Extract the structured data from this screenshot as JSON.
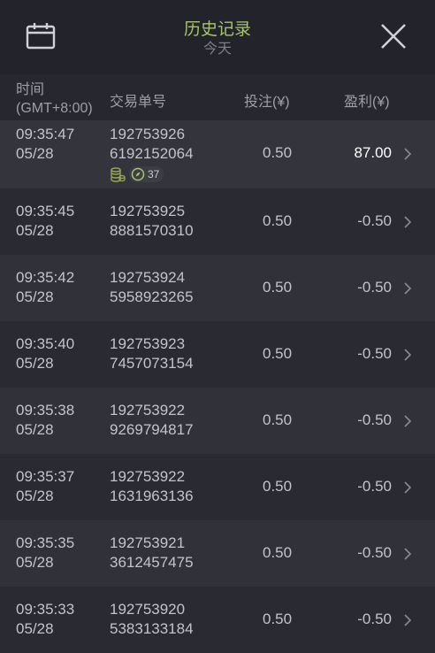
{
  "header": {
    "title": "历史记录",
    "subtitle": "今天",
    "accent_color": "#a7c46a",
    "left_icon": "calendar-icon",
    "right_icon": "close-icon"
  },
  "columns": {
    "time_line1": "时间",
    "time_line2": "(GMT+8:00)",
    "order": "交易单号",
    "bet": "投注(¥)",
    "profit": "盈利(¥)"
  },
  "rows": [
    {
      "time": "09:35:47",
      "date": "05/28",
      "order1": "192753926",
      "order2": "6192152064",
      "bet": "0.50",
      "profit": "87.00",
      "badge_icon": "coins-icon",
      "badge_count": "37"
    },
    {
      "time": "09:35:45",
      "date": "05/28",
      "order1": "192753925",
      "order2": "8881570310",
      "bet": "0.50",
      "profit": "-0.50"
    },
    {
      "time": "09:35:42",
      "date": "05/28",
      "order1": "192753924",
      "order2": "5958923265",
      "bet": "0.50",
      "profit": "-0.50"
    },
    {
      "time": "09:35:40",
      "date": "05/28",
      "order1": "192753923",
      "order2": "7457073154",
      "bet": "0.50",
      "profit": "-0.50"
    },
    {
      "time": "09:35:38",
      "date": "05/28",
      "order1": "192753922",
      "order2": "9269794817",
      "bet": "0.50",
      "profit": "-0.50"
    },
    {
      "time": "09:35:37",
      "date": "05/28",
      "order1": "192753922",
      "order2": "1631963136",
      "bet": "0.50",
      "profit": "-0.50"
    },
    {
      "time": "09:35:35",
      "date": "05/28",
      "order1": "192753921",
      "order2": "3612457475",
      "bet": "0.50",
      "profit": "-0.50"
    },
    {
      "time": "09:35:33",
      "date": "05/28",
      "order1": "192753920",
      "order2": "5383133184",
      "bet": "0.50",
      "profit": "-0.50"
    }
  ]
}
